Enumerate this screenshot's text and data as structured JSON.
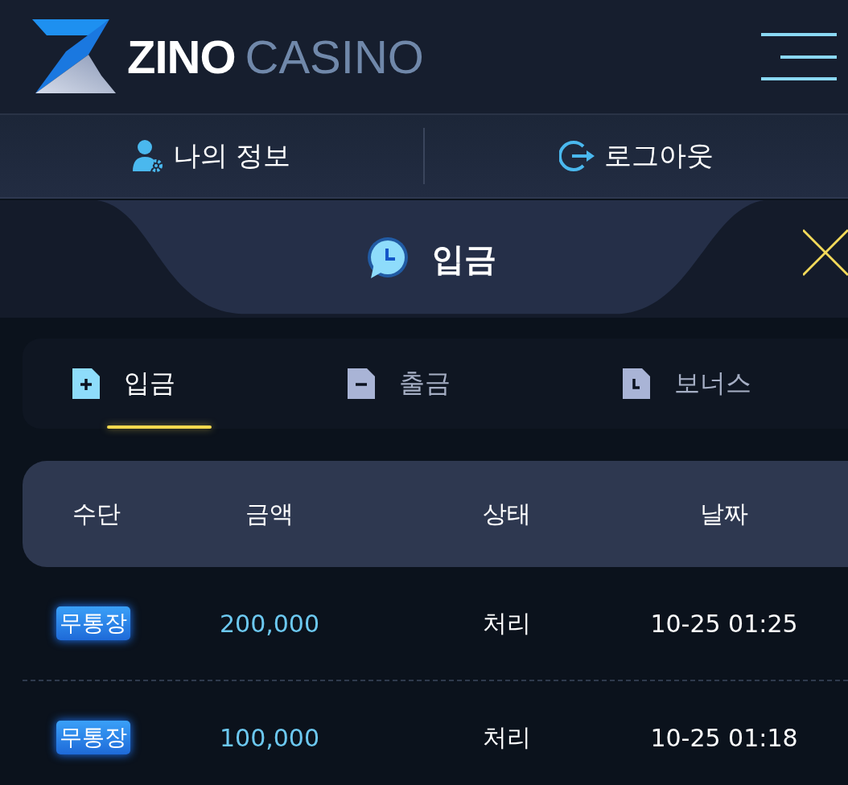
{
  "header": {
    "logo": {
      "brand": "ZINO",
      "suffix": "CASINO"
    }
  },
  "nav": [
    {
      "label": "나의 정보",
      "kind": "profile"
    },
    {
      "label": "로그아웃",
      "kind": "logout"
    }
  ],
  "panel": {
    "title": "입금",
    "tabs": [
      {
        "label": "입금",
        "kind": "plus",
        "selected": true
      },
      {
        "label": "출금",
        "kind": "minus",
        "selected": false
      },
      {
        "label": "보너스",
        "kind": "clock",
        "selected": false
      }
    ],
    "table": {
      "columns": [
        "수단",
        "금액",
        "상태",
        "날짜"
      ],
      "rows": [
        {
          "method": "무통장",
          "amount": "200,000",
          "status": "처리",
          "date": "10-25 01:25"
        },
        {
          "method": "무통장",
          "amount": "100,000",
          "status": "처리",
          "date": "10-25 01:18"
        }
      ]
    }
  }
}
